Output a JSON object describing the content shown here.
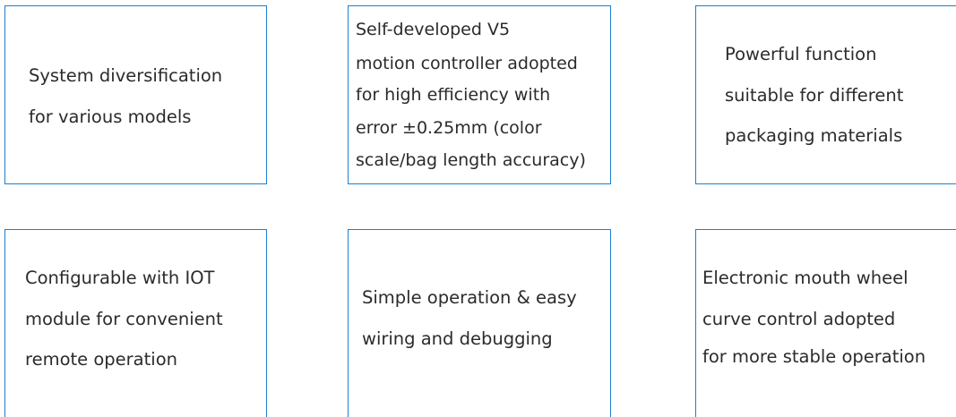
{
  "features": [
    {
      "lines": [
        "System diversification",
        "for various models"
      ]
    },
    {
      "lines": [
        "Self-developed V5",
        "motion controller adopted",
        "for high efficiency with",
        "error ±0.25mm (color",
        "scale/bag length accuracy)"
      ]
    },
    {
      "lines": [
        "Powerful function",
        "suitable for different",
        "packaging materials"
      ]
    },
    {
      "lines": [
        "Configurable with IOT",
        "module for convenient",
        "remote operation"
      ]
    },
    {
      "lines": [
        "Simple operation & easy",
        "wiring and debugging"
      ]
    },
    {
      "lines": [
        "Electronic mouth wheel",
        "curve control adopted",
        "for more stable operation"
      ]
    }
  ]
}
